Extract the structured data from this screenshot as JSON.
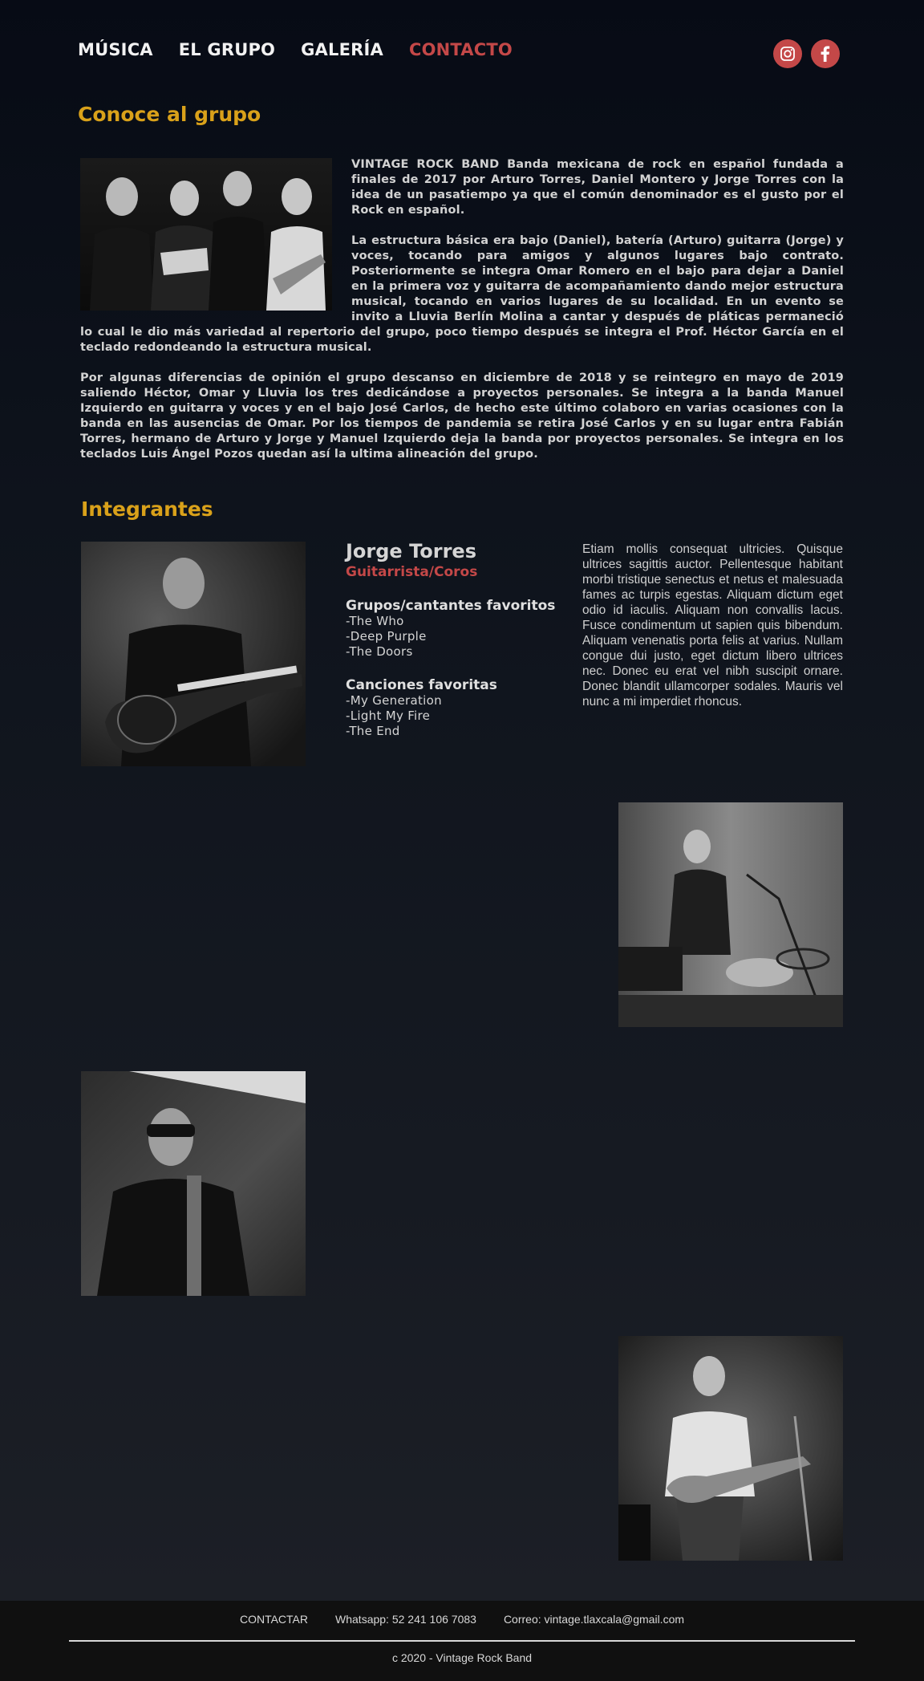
{
  "nav": {
    "items": [
      "MÚSICA",
      "EL GRUPO",
      "GALERÍA",
      "CONTACTO"
    ],
    "active": "CONTACTO"
  },
  "social": {
    "icons": [
      "instagram-icon",
      "facebook-icon"
    ]
  },
  "about": {
    "title": "Conoce al grupo",
    "paragraphs": [
      "VINTAGE ROCK BAND Banda mexicana de rock en español fundada a finales de 2017 por Arturo Torres, Daniel Montero y Jorge Torres con la idea de un pasatiempo ya que el común denominador es el gusto por el Rock en español.",
      "La estructura básica era bajo (Daniel), batería (Arturo) guitarra (Jorge) y voces, tocando para amigos y algunos lugares bajo contrato. Posteriormente se integra Omar Romero en el bajo para dejar a Daniel en la primera voz y guitarra de acompañamiento dando mejor estructura musical, tocando en varios lugares de su localidad. En un evento se invito a Lluvia Berlín Molina  a cantar y después de pláticas permaneció lo cual le dio más variedad al repertorio del grupo, poco tiempo después se integra el Prof. Héctor García en el teclado redondeando la estructura musical.",
      "Por algunas diferencias de opinión el grupo descanso en diciembre de 2018 y se reintegro en mayo de 2019 saliendo Héctor, Omar y  Lluvia los tres dedicándose a proyectos personales. Se integra a la banda Manuel Izquierdo en guitarra y voces y en el bajo José Carlos, de hecho este último colaboro en varias ocasiones con la banda en las ausencias de Omar. Por los tiempos de pandemia se retira José Carlos y en su lugar entra Fabián Torres, hermano de Arturo y Jorge y Manuel Izquierdo deja la banda por proyectos personales. Se integra en los teclados Luis Ángel Pozos quedan así la ultima alineación del grupo."
    ]
  },
  "members": {
    "title": "Integrantes",
    "featured": {
      "name": "Jorge Torres",
      "role": "Guitarrista/Coros",
      "groups_title": "Grupos/cantantes favoritos",
      "groups": [
        "-The Who",
        "-Deep Purple",
        "-The Doors"
      ],
      "songs_title": "Canciones favoritas",
      "songs": [
        "-My Generation",
        "-Light My Fire",
        "-The End"
      ],
      "bio": "Etiam mollis consequat ultricies. Quisque ultrices sagittis auctor. Pellentesque habitant morbi tristique senectus et netus et malesuada fames ac turpis egestas. Aliquam dictum eget odio id iaculis. Aliquam non convallis lacus. Fusce condimentum ut sapien quis bibendum. Aliquam venenatis porta felis at varius. Nullam congue dui justo, eget dictum libero ultrices nec. Donec eu erat vel nibh suscipit ornare. Donec blandit ullamcorper sodales. Mauris vel nunc a mi imperdiet rhoncus."
    }
  },
  "footer": {
    "contact": "CONTACTAR",
    "whatsapp": "Whatsapp: 52 241 106 7083",
    "email": "Correo:  vintage.tlaxcala@gmail.com",
    "copyright": "c 2020 - Vintage Rock Band"
  }
}
